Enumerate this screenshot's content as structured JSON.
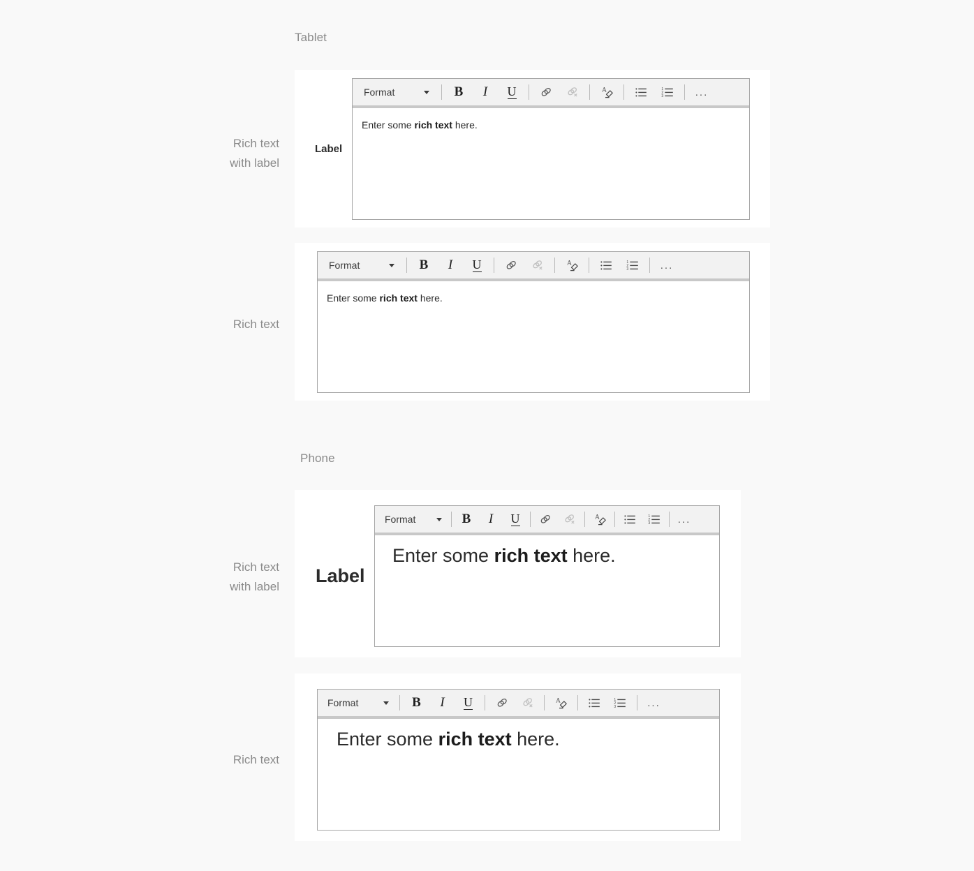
{
  "page": {
    "background": "#f9f9f9",
    "card_background": "#ffffff",
    "toolbar_background": "#f2f2f2",
    "toolbar_accent": "#c8c8c8",
    "editor_border": "#a6a6a6",
    "label_muted_color": "#8a8a8a",
    "text_color": "#2b2b2b"
  },
  "sections": [
    {
      "id": "tablet",
      "heading": "Tablet"
    },
    {
      "id": "phone",
      "heading": "Phone"
    }
  ],
  "rows": [
    {
      "id": "tablet-with-label",
      "label_line1": "Rich text",
      "label_line2": "with label",
      "field_label": "Label"
    },
    {
      "id": "tablet-plain",
      "label_line1": "Rich text",
      "label_line2": "",
      "field_label": ""
    },
    {
      "id": "phone-with-label",
      "label_line1": "Rich text",
      "label_line2": "with label",
      "field_label": "Label"
    },
    {
      "id": "phone-plain",
      "label_line1": "Rich text",
      "label_line2": "",
      "field_label": ""
    }
  ],
  "toolbar": {
    "format_label": "Format",
    "caret_icon": "chevron-down-icon",
    "buttons": [
      {
        "name": "bold-button",
        "icon": "bold-icon",
        "label": "B"
      },
      {
        "name": "italic-button",
        "icon": "italic-icon",
        "label": "I"
      },
      {
        "name": "underline-button",
        "icon": "underline-icon",
        "label": "U"
      },
      {
        "name": "insert-link-button",
        "icon": "link-icon",
        "label": ""
      },
      {
        "name": "remove-link-button",
        "icon": "unlink-icon",
        "label": ""
      },
      {
        "name": "clear-formatting-button",
        "icon": "clear-formatting-icon",
        "label": ""
      },
      {
        "name": "bulleted-list-button",
        "icon": "bulleted-list-icon",
        "label": ""
      },
      {
        "name": "numbered-list-button",
        "icon": "numbered-list-icon",
        "label": ""
      },
      {
        "name": "more-options-button",
        "icon": "ellipsis-icon",
        "label": "..."
      }
    ]
  },
  "editor_content": {
    "prefix": "Enter some ",
    "bold": "rich text",
    "suffix": " here."
  }
}
